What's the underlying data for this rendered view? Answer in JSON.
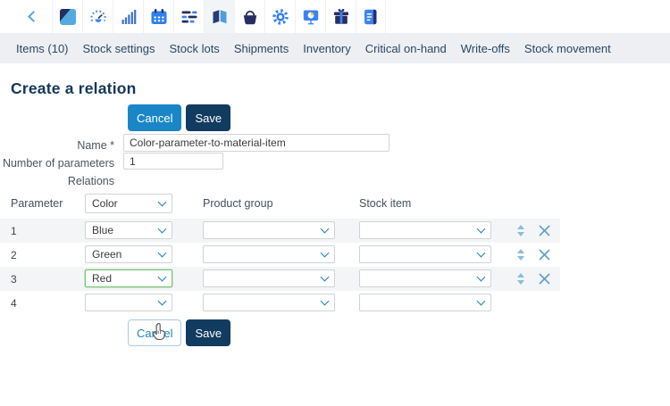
{
  "toolbar": {
    "icons": [
      "back-chevron",
      "logo-diagonal",
      "gauge",
      "bar-chart",
      "calendar",
      "task-list",
      "book",
      "basket",
      "gear",
      "presentation",
      "gift",
      "notebook"
    ],
    "active_icon": "book"
  },
  "nav": {
    "items": [
      "Items (10)",
      "Stock settings",
      "Stock lots",
      "Shipments",
      "Inventory",
      "Critical on-hand",
      "Write-offs",
      "Stock movement"
    ]
  },
  "page": {
    "title": "Create a relation"
  },
  "top_actions": {
    "cancel": "Cancel",
    "save": "Save"
  },
  "form": {
    "name_label": "Name *",
    "name_value": "Color-parameter-to-material-item",
    "parameters_label": "Number of parameters",
    "parameters_value": "1",
    "relations_label": "Relations"
  },
  "relations_table": {
    "parameter_label": "Parameter",
    "parameter_value": "Color",
    "product_group_label": "Product group",
    "stock_item_label": "Stock item",
    "rows": [
      {
        "num": "1",
        "parameter": "Blue",
        "product_group": "",
        "stock_item": ""
      },
      {
        "num": "2",
        "parameter": "Green",
        "product_group": "",
        "stock_item": ""
      },
      {
        "num": "3",
        "parameter": "Red",
        "product_group": "",
        "stock_item": ""
      },
      {
        "num": "4",
        "parameter": "",
        "product_group": "",
        "stock_item": ""
      }
    ]
  },
  "bottom_actions": {
    "cancel": "Cancel",
    "save": "Save"
  },
  "colors": {
    "primary_blue": "#1a86c8",
    "dark_navy": "#123b60",
    "nav_background": "#edeff2",
    "nav_text": "#2a4763",
    "accent_green": "#77c47a",
    "icon_blue": "#2f80ed",
    "icon_navy": "#272e63",
    "row_shade": "#f4f5f6"
  }
}
